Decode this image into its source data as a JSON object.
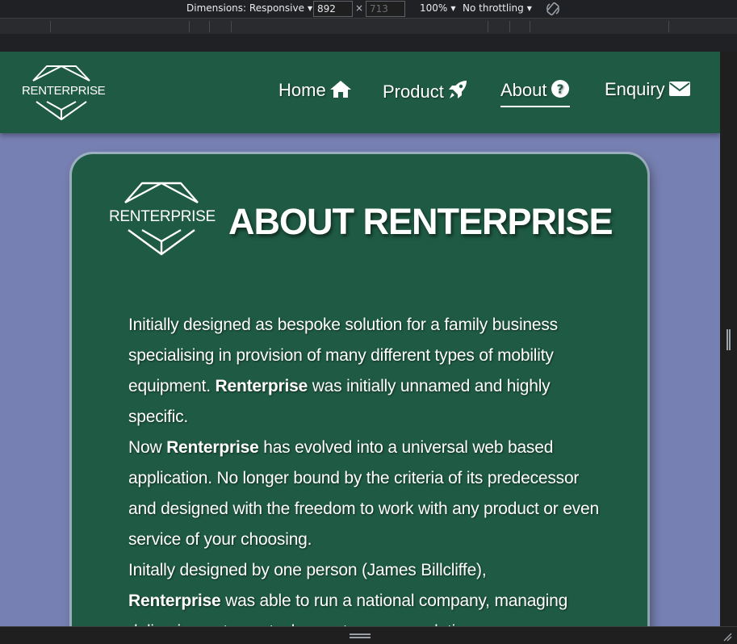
{
  "devtools": {
    "dimensions_label": "Dimensions: Responsive",
    "width_value": "892",
    "times_sign": "×",
    "height_placeholder": "713",
    "zoom_label": "100%",
    "throttling_label": "No throttling"
  },
  "nav": {
    "logo_text": "RENTERPRISE",
    "items": [
      {
        "label": "Home",
        "icon": "home-icon"
      },
      {
        "label": "Product",
        "icon": "rocket-icon"
      },
      {
        "label": "About",
        "icon": "question-circle-icon",
        "active": true
      },
      {
        "label": "Enquiry",
        "icon": "envelope-icon"
      }
    ]
  },
  "about": {
    "logo_text": "RENTERPRISE",
    "title": "ABOUT RENTERPRISE",
    "brand": "Renterprise",
    "p1_a": "Initially designed as bespoke solution for a family business specialising in provision of many different types of mobility equipment.",
    "p1_b": "was initially unnamed and highly specific.",
    "p2_a": "Now",
    "p2_b": "has evolved into a universal web based application. No longer bound by the criteria of its predecessor and designed with the freedom to work with any product or even service of your choosing.",
    "p3_a": "Initally designed by one person (James Billcliffe),",
    "p3_b": "was able to run a national company,",
    "p3_c": "managing delivering, returns, tasks, customer, completions"
  },
  "colors": {
    "page_background": "#7780b2",
    "brand_green": "#1f5b44",
    "text": "#ffffff"
  }
}
